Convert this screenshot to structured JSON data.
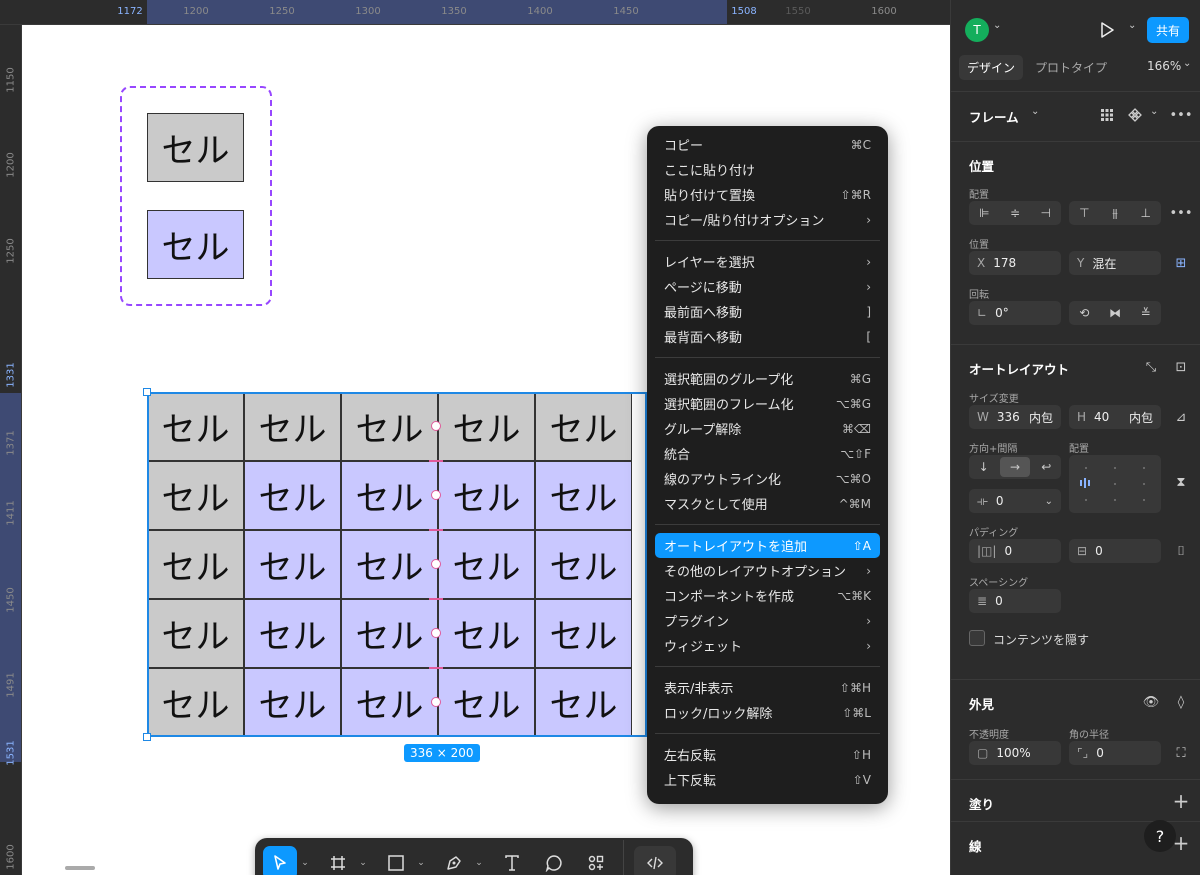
{
  "ruler_top": {
    "ticks": [
      "1200",
      "1250",
      "1300",
      "1350",
      "1400",
      "1450",
      "1550",
      "1600"
    ],
    "sel_start": "1172",
    "sel_end": "1508"
  },
  "ruler_left": {
    "ticks": [
      "1150",
      "1200",
      "1250",
      "1450",
      "1600"
    ],
    "highlights": [
      "1331",
      "1371",
      "1411",
      "1491",
      "1531"
    ]
  },
  "canvas": {
    "group_cells": [
      {
        "text": "セル",
        "fill": "gray"
      },
      {
        "text": "セル",
        "fill": "blue"
      }
    ],
    "table_rows": [
      [
        "セル",
        "セル",
        "セル",
        "セル",
        "セル"
      ],
      [
        "セル",
        "セル",
        "セル",
        "セル",
        "セル"
      ],
      [
        "セル",
        "セル",
        "セル",
        "セル",
        "セル"
      ],
      [
        "セル",
        "セル",
        "セル",
        "セル",
        "セル"
      ],
      [
        "セル",
        "セル",
        "セル",
        "セル",
        "セル"
      ]
    ],
    "size_label": "336 × 200"
  },
  "toolbar": {
    "tools": [
      "move-tool",
      "frame-tool",
      "shape-tool",
      "pen-tool",
      "text-tool",
      "comment-tool",
      "actions-tool",
      "dev-mode-tool"
    ]
  },
  "context_menu": {
    "groups": [
      [
        {
          "label": "コピー",
          "shortcut": "⌘C"
        },
        {
          "label": "ここに貼り付け",
          "shortcut": ""
        },
        {
          "label": "貼り付けて置換",
          "shortcut": "⇧⌘R"
        },
        {
          "label": "コピー/貼り付けオプション",
          "shortcut": "›"
        }
      ],
      [
        {
          "label": "レイヤーを選択",
          "shortcut": "›"
        },
        {
          "label": "ページに移動",
          "shortcut": "›"
        },
        {
          "label": "最前面へ移動",
          "shortcut": "]"
        },
        {
          "label": "最背面へ移動",
          "shortcut": "["
        }
      ],
      [
        {
          "label": "選択範囲のグループ化",
          "shortcut": "⌘G"
        },
        {
          "label": "選択範囲のフレーム化",
          "shortcut": "⌥⌘G"
        },
        {
          "label": "グループ解除",
          "shortcut": "⌘⌫"
        },
        {
          "label": "統合",
          "shortcut": "⌥⇧F"
        },
        {
          "label": "線のアウトライン化",
          "shortcut": "⌥⌘O"
        },
        {
          "label": "マスクとして使用",
          "shortcut": "^⌘M"
        }
      ],
      [
        {
          "label": "オートレイアウトを追加",
          "shortcut": "⇧A",
          "highlight": true
        },
        {
          "label": "その他のレイアウトオプション",
          "shortcut": "›"
        },
        {
          "label": "コンポーネントを作成",
          "shortcut": "⌥⌘K"
        },
        {
          "label": "プラグイン",
          "shortcut": "›"
        },
        {
          "label": "ウィジェット",
          "shortcut": "›"
        }
      ],
      [
        {
          "label": "表示/非表示",
          "shortcut": "⇧⌘H"
        },
        {
          "label": "ロック/ロック解除",
          "shortcut": "⇧⌘L"
        }
      ],
      [
        {
          "label": "左右反転",
          "shortcut": "⇧H"
        },
        {
          "label": "上下反転",
          "shortcut": "⇧V"
        }
      ]
    ]
  },
  "panel": {
    "avatar": "T",
    "share": "共有",
    "tab_design": "デザイン",
    "tab_prototype": "プロトタイプ",
    "zoom": "166%",
    "frame_label": "フレーム",
    "position_title": "位置",
    "align_label": "配置",
    "pos_label": "位置",
    "x_prefix": "X",
    "x_value": "178",
    "y_prefix": "Y",
    "y_value": "混在",
    "rotation_label": "回転",
    "rotation_value": "0°",
    "autolayout_title": "オートレイアウト",
    "size_label": "サイズ変更",
    "w_prefix": "W",
    "w_value": "336",
    "w_mode": "内包",
    "h_prefix": "H",
    "h_value": "40",
    "h_mode": "内包",
    "direction_label": "方向+間隔",
    "arrangement_label": "配置",
    "gap_value": "0",
    "padding_label": "パディング",
    "pad_h": "0",
    "pad_v": "0",
    "spacing_label": "スペーシング",
    "spacing_value": "0",
    "clip_label": "コンテンツを隠す",
    "appearance_title": "外見",
    "opacity_label": "不透明度",
    "opacity_value": "100%",
    "radius_label": "角の半径",
    "radius_value": "0",
    "fill_title": "塗り",
    "stroke_title": "線",
    "help": "?"
  }
}
